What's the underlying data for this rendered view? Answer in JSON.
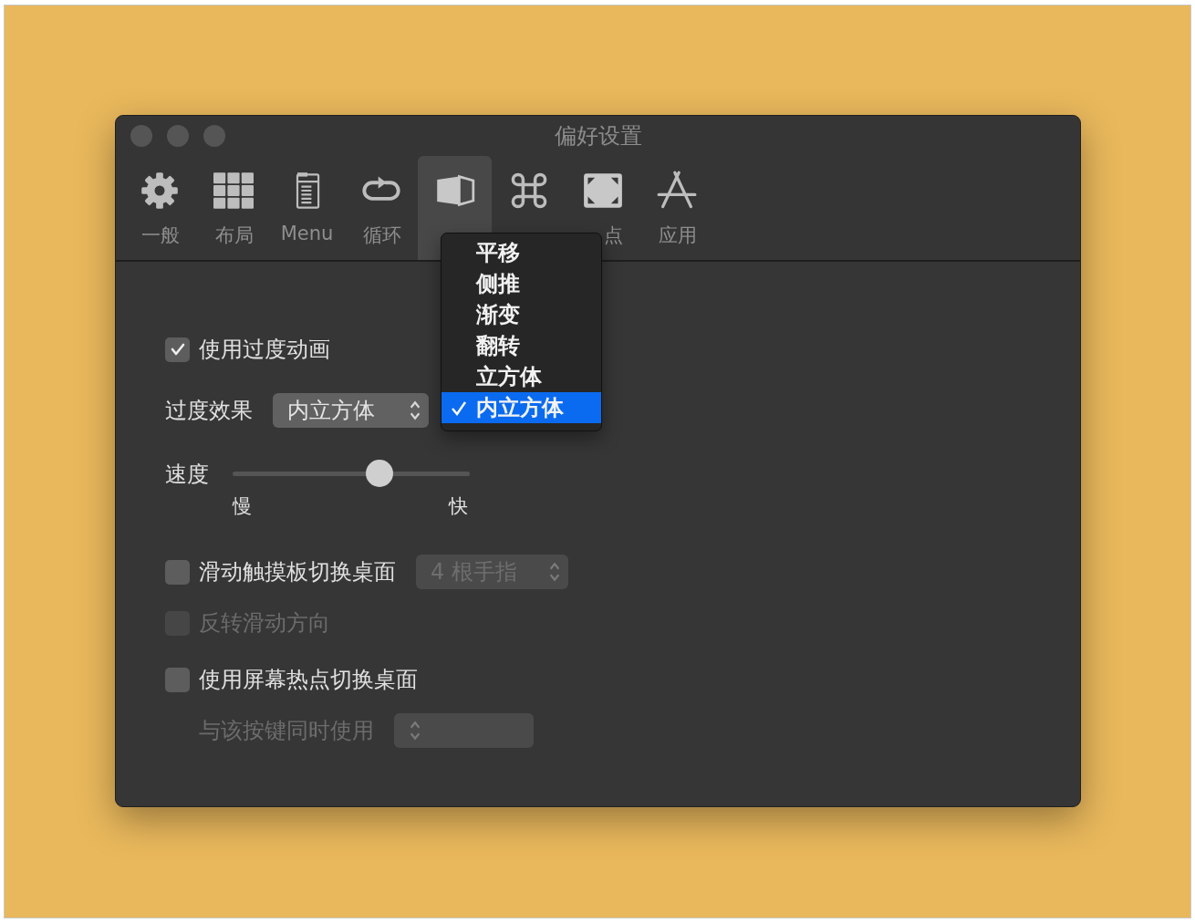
{
  "window": {
    "title": "偏好设置"
  },
  "toolbar": [
    {
      "kind": "gear",
      "label": "一般",
      "selected": false
    },
    {
      "kind": "grid",
      "label": "布局",
      "selected": false
    },
    {
      "kind": "document",
      "label": "Menu",
      "selected": false
    },
    {
      "kind": "loop",
      "label": "循环",
      "selected": false
    },
    {
      "kind": "cube",
      "selected": true
    },
    {
      "kind": "command",
      "selected": false
    },
    {
      "kind": "corners",
      "label": "点",
      "selected": false
    },
    {
      "kind": "appstore",
      "label": "应用",
      "selected": false
    }
  ],
  "menu": {
    "items": [
      {
        "label": "平移",
        "selected": false
      },
      {
        "label": "侧推",
        "selected": false
      },
      {
        "label": "渐变",
        "selected": false
      },
      {
        "label": "翻转",
        "selected": false
      },
      {
        "label": "立方体",
        "selected": false
      },
      {
        "label": "内立方体",
        "selected": true
      }
    ]
  },
  "animation": {
    "label": "使用过度动画",
    "checked": true,
    "disabled": false
  },
  "effect": {
    "label": "过度效果",
    "value": "内立方体",
    "disabled": false
  },
  "speed": {
    "label": "速度",
    "level": 0.62,
    "min_label": "慢",
    "max_label": "快"
  },
  "trackpad": {
    "label": "滑动触摸板切换桌面",
    "checked": false,
    "disabled": false,
    "popup": {
      "value": "4 根手指",
      "disabled": true
    }
  },
  "reverse": {
    "label": "反转滑动方向",
    "checked": false,
    "disabled": true
  },
  "hotcorner": {
    "label": "使用屏幕热点切换桌面",
    "checked": false,
    "disabled": false
  },
  "modifier": {
    "label": "与该按键同时使用",
    "disabled": true,
    "popup": {
      "disabled": true
    }
  }
}
